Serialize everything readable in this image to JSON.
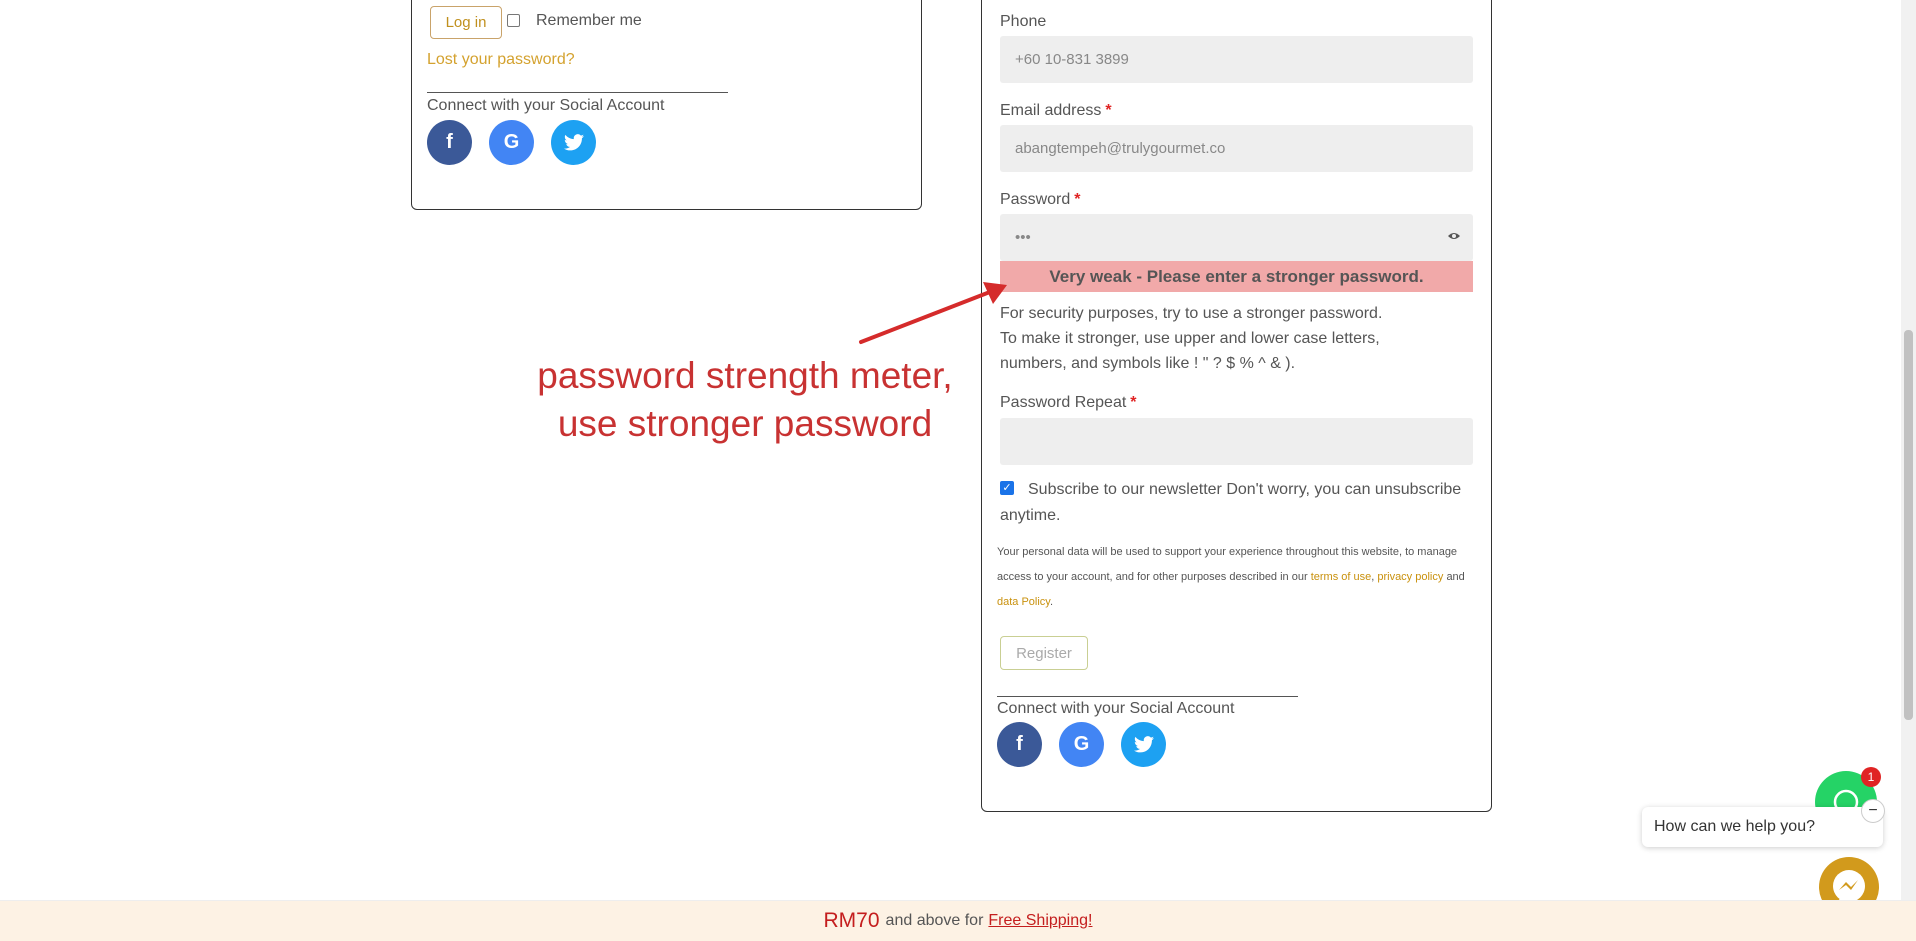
{
  "login": {
    "login_button": "Log in",
    "remember_label": "Remember me",
    "lost_password": "Lost your password?",
    "social_label": "Connect with your Social Account"
  },
  "register": {
    "phone_label": "Phone",
    "phone_value": "+60 10-831 3899",
    "email_label": "Email address",
    "email_value": "abangtempeh@trulygourmet.co",
    "password_label": "Password",
    "password_value": "•••",
    "required_mark": "*",
    "strength_text": "Very weak - Please enter a stronger password.",
    "hint_line1": "For security purposes, try to use a stronger password.",
    "hint_line2": "To make it stronger, use upper and lower case letters,",
    "hint_line3": "numbers, and symbols like ! \" ? $ % ^ & ).",
    "password_repeat_label": "Password Repeat",
    "newsletter_text": "Subscribe to our newsletter Don't worry, you can unsubscribe anytime.",
    "privacy_prefix": "Your personal data will be used to support your experience throughout this website, to manage access to your account, and for other purposes described in our",
    "terms_link": "terms of use",
    "comma": ",",
    "privacy_link": "privacy policy",
    "and_text": "and",
    "data_policy_link": "data Policy",
    "period": ".",
    "register_button": "Register",
    "social_label": "Connect with your Social Account"
  },
  "social": {
    "facebook_glyph": "f",
    "google_glyph": "G"
  },
  "annotation": {
    "line1": "password strength meter,",
    "line2": "use stronger password"
  },
  "banner": {
    "amount": "RM70",
    "text": "and above for",
    "link": "Free Shipping!"
  },
  "chat": {
    "badge_count": "1",
    "prompt": "How can we help you?",
    "close_glyph": "−"
  },
  "colors": {
    "accent_gold": "#c9910d",
    "strength_bg": "#f1a9a9",
    "annotation_red": "#c83232"
  }
}
